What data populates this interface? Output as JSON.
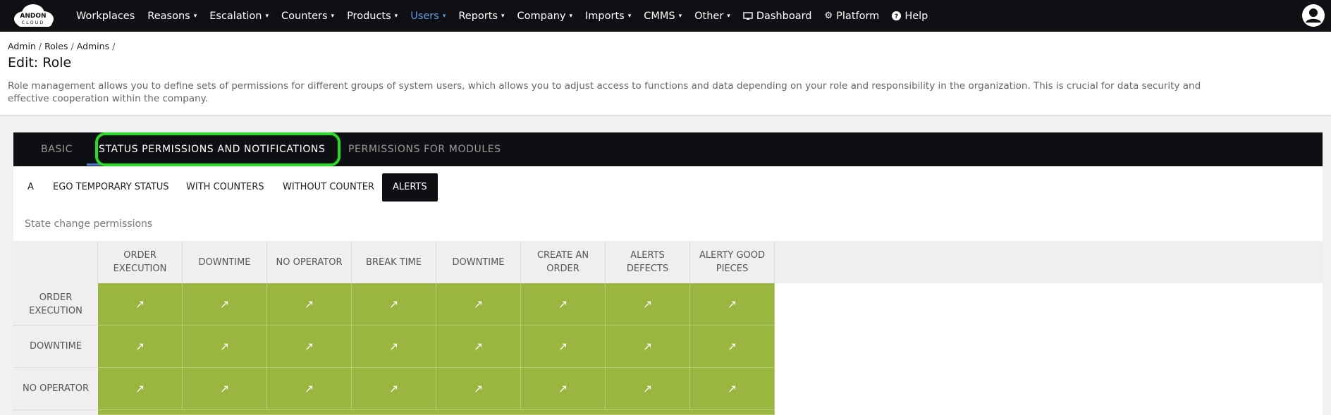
{
  "navbar": {
    "logo_text": "ANDON CLOUD",
    "items": [
      {
        "label": "Workplaces",
        "caret": false
      },
      {
        "label": "Reasons",
        "caret": true
      },
      {
        "label": "Escalation",
        "caret": true
      },
      {
        "label": "Counters",
        "caret": true
      },
      {
        "label": "Products",
        "caret": true
      },
      {
        "label": "Users",
        "caret": true,
        "active": true
      },
      {
        "label": "Reports",
        "caret": true
      },
      {
        "label": "Company",
        "caret": true
      },
      {
        "label": "Imports",
        "caret": true
      },
      {
        "label": "CMMS",
        "caret": true
      },
      {
        "label": "Other",
        "caret": true
      }
    ],
    "dashboard_label": "Dashboard",
    "platform_label": "Platform",
    "help_label": "Help",
    "caret_glyph": "▾",
    "active_color": "#5b9ce8"
  },
  "breadcrumb": {
    "items": [
      "Admin",
      "Roles",
      "Admins"
    ],
    "separator": "/"
  },
  "page": {
    "title": "Edit: Role",
    "description": "Role management allows you to define sets of permissions for different groups of system users, which allows you to adjust access to functions and data depending on your role and responsibility in the organization. This is crucial for data security and effective cooperation within the company."
  },
  "tabs": {
    "basic": "BASIC",
    "status": "STATUS PERMISSIONS AND NOTIFICATIONS",
    "modules": "PERMISSIONS FOR MODULES",
    "active": "status"
  },
  "subtabs": {
    "items": [
      "A",
      "EGO TEMPORARY STATUS",
      "WITH COUNTERS",
      "WITHOUT COUNTER",
      "ALERTS"
    ],
    "active_index": 4
  },
  "section_label": "State change permissions",
  "matrix": {
    "columns": [
      "ORDER EXECUTION",
      "DOWNTIME",
      "NO OPERATOR",
      "BREAK TIME",
      "DOWNTIME",
      "CREATE AN ORDER",
      "ALERTS DEFECTS",
      "ALERTY GOOD PIECES"
    ],
    "rows": [
      "ORDER EXECUTION",
      "DOWNTIME",
      "NO OPERATOR"
    ],
    "cell_glyph": "↗",
    "allowed_color": "#9ab63e"
  }
}
